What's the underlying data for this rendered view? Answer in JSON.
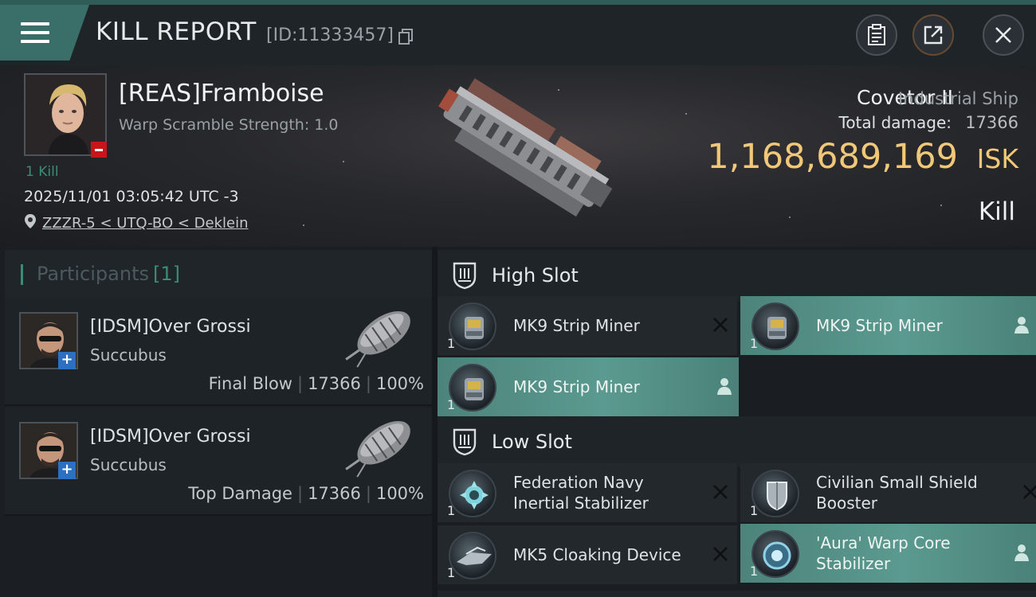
{
  "header": {
    "title": "KILL REPORT",
    "report_id": "[ID:11333457]"
  },
  "victim": {
    "name": "[REAS]Framboise",
    "warp_scramble": "Warp Scramble Strength: 1.0",
    "kills": "1 Kill",
    "timestamp": "2025/11/01 03:05:42 UTC -3",
    "location": "ZZZR-5 < UTQ-BO < Deklein"
  },
  "ship": {
    "name": "Covetor II",
    "class": "Industrial Ship",
    "total_damage_label": "Total damage:",
    "total_damage_value": "17366",
    "isk_value": "1,168,689,169",
    "isk_unit": "ISK",
    "kill_type": "Kill"
  },
  "participants": {
    "title": "Participants",
    "count": "[1]",
    "items": [
      {
        "name": "[IDSM]Over Grossi",
        "ship": "Succubus",
        "role": "Final Blow",
        "damage": "17366",
        "percent": "100%"
      },
      {
        "name": "[IDSM]Over Grossi",
        "ship": "Succubus",
        "role": "Top Damage",
        "damage": "17366",
        "percent": "100%"
      }
    ]
  },
  "high_slot": {
    "title": "High Slot",
    "modules": [
      {
        "name": "MK9 Strip Miner",
        "qty": "1",
        "status": "destroyed"
      },
      {
        "name": "MK9 Strip Miner",
        "qty": "1",
        "status": "dropped"
      },
      {
        "name": "MK9 Strip Miner",
        "qty": "1",
        "status": "dropped"
      }
    ]
  },
  "low_slot": {
    "title": "Low Slot",
    "modules": [
      {
        "name_line1": "Federation Navy",
        "name_line2": "Inertial Stabilizer",
        "qty": "1",
        "status": "destroyed"
      },
      {
        "name_line1": "Civilian Small Shield",
        "name_line2": "Booster",
        "qty": "1",
        "status": "destroyed"
      },
      {
        "name_line1": "MK5 Cloaking Device",
        "name_line2": "",
        "qty": "1",
        "status": "destroyed"
      },
      {
        "name_line1": "'Aura' Warp Core",
        "name_line2": "Stabilizer",
        "qty": "1",
        "status": "dropped"
      }
    ]
  },
  "icons": {
    "menu": "menu-icon",
    "copy": "copy-icon",
    "clipboard": "clipboard-icon",
    "share": "share-icon",
    "close": "close-icon",
    "location": "location-pin-icon",
    "slot": "slot-shield-icon",
    "destroyed": "x-icon",
    "dropped": "person-icon"
  },
  "colors": {
    "accent_teal": "#3d8a79",
    "highlight_row": "#5b9a90",
    "isk_gold": "#f0c878",
    "remove_red": "#c8151b",
    "plus_blue": "#2d6fc1"
  }
}
